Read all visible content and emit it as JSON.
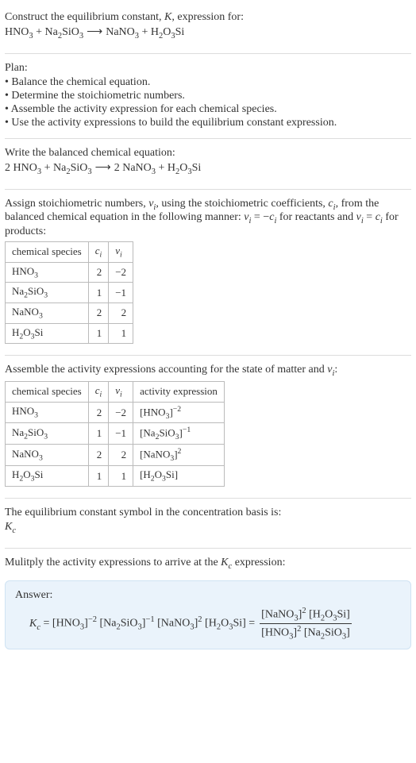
{
  "header": {
    "prompt": "Construct the equilibrium constant, K, expression for:",
    "equation": "HNO₃ + Na₂SiO₃ ⟶ NaNO₃ + H₂O₃Si"
  },
  "plan": {
    "heading": "Plan:",
    "items": [
      "Balance the chemical equation.",
      "Determine the stoichiometric numbers.",
      "Assemble the activity expression for each chemical species.",
      "Use the activity expressions to build the equilibrium constant expression."
    ]
  },
  "balanced": {
    "heading": "Write the balanced chemical equation:",
    "equation": "2 HNO₃ + Na₂SiO₃ ⟶ 2 NaNO₃ + H₂O₃Si"
  },
  "stoich": {
    "intro_a": "Assign stoichiometric numbers, νᵢ, using the stoichiometric coefficients, cᵢ, from the balanced chemical equation in the following manner: νᵢ = −cᵢ for reactants and νᵢ = cᵢ for products:",
    "cols": {
      "species": "chemical species",
      "ci": "cᵢ",
      "vi": "νᵢ"
    },
    "rows": [
      {
        "species": "HNO₃",
        "ci": "2",
        "vi": "−2"
      },
      {
        "species": "Na₂SiO₃",
        "ci": "1",
        "vi": "−1"
      },
      {
        "species": "NaNO₃",
        "ci": "2",
        "vi": "2"
      },
      {
        "species": "H₂O₃Si",
        "ci": "1",
        "vi": "1"
      }
    ]
  },
  "activity": {
    "intro": "Assemble the activity expressions accounting for the state of matter and νᵢ:",
    "cols": {
      "species": "chemical species",
      "ci": "cᵢ",
      "vi": "νᵢ",
      "expr": "activity expression"
    },
    "rows": [
      {
        "species": "HNO₃",
        "ci": "2",
        "vi": "−2",
        "expr": "[HNO₃]⁻²"
      },
      {
        "species": "Na₂SiO₃",
        "ci": "1",
        "vi": "−1",
        "expr": "[Na₂SiO₃]⁻¹"
      },
      {
        "species": "NaNO₃",
        "ci": "2",
        "vi": "2",
        "expr": "[NaNO₃]²"
      },
      {
        "species": "H₂O₃Si",
        "ci": "1",
        "vi": "1",
        "expr": "[H₂O₃Si]"
      }
    ]
  },
  "kc_symbol": {
    "line1": "The equilibrium constant symbol in the concentration basis is:",
    "symbol": "K𝚌"
  },
  "multiply": {
    "line": "Mulitply the activity expressions to arrive at the K𝚌 expression:"
  },
  "answer": {
    "label": "Answer:",
    "lhs": "K𝚌 = [HNO₃]⁻² [Na₂SiO₃]⁻¹ [NaNO₃]² [H₂O₃Si] =",
    "frac_num": "[NaNO₃]² [H₂O₃Si]",
    "frac_den": "[HNO₃]² [Na₂SiO₃]"
  }
}
